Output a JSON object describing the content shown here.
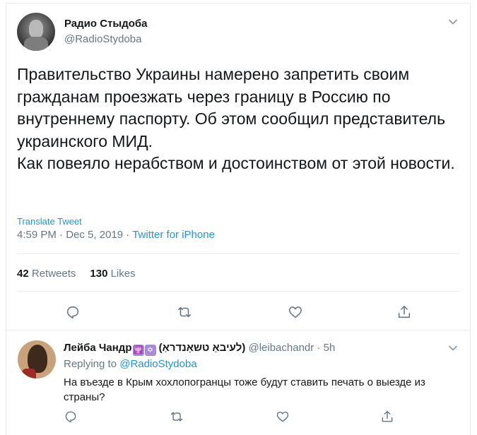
{
  "tweet": {
    "author_name": "Радио Стыдоба",
    "author_handle": "@RadioStydoba",
    "avatar_icon": "statue-of-liberty-facepalm-avatar",
    "text": "Правительство Украины намерено запретить своим гражданам проезжать через границу в Россию по внутреннему паспорту. Об этом сообщил представитель украинского МИД.\nКак повеяло нерабством и достоинством от этой новости.",
    "translate_label": "Translate Tweet",
    "time": "4:59 PM",
    "date": "Dec 5, 2019",
    "separator": "·",
    "source": "Twitter for iPhone",
    "retweets_count": "42",
    "retweets_label": "Retweets",
    "likes_count": "130",
    "likes_label": "Likes",
    "action_icons": [
      "reply-icon",
      "retweet-icon",
      "like-icon",
      "share-icon"
    ]
  },
  "reply": {
    "author_name": "Лейба Чандр",
    "emoji_badges": [
      "🕎",
      "✡"
    ],
    "name_extra": "(לעיבאַ טשאַנדראַ)",
    "author_handle": "@leibachandr",
    "separator": "·",
    "time_ago": "5h",
    "replying_to_label": "Replying to",
    "replying_to_handle": "@RadioStydoba",
    "text": "На въезде в Крым хохлопогранцы тоже будут ставить печать о выезде из страны?",
    "action_icons": [
      "reply-icon",
      "retweet-icon",
      "like-icon",
      "share-icon"
    ]
  },
  "colors": {
    "accent": "#1b95e0",
    "secondary_text": "#657786",
    "primary_text": "#14171a",
    "divider": "#e6ecf0"
  }
}
